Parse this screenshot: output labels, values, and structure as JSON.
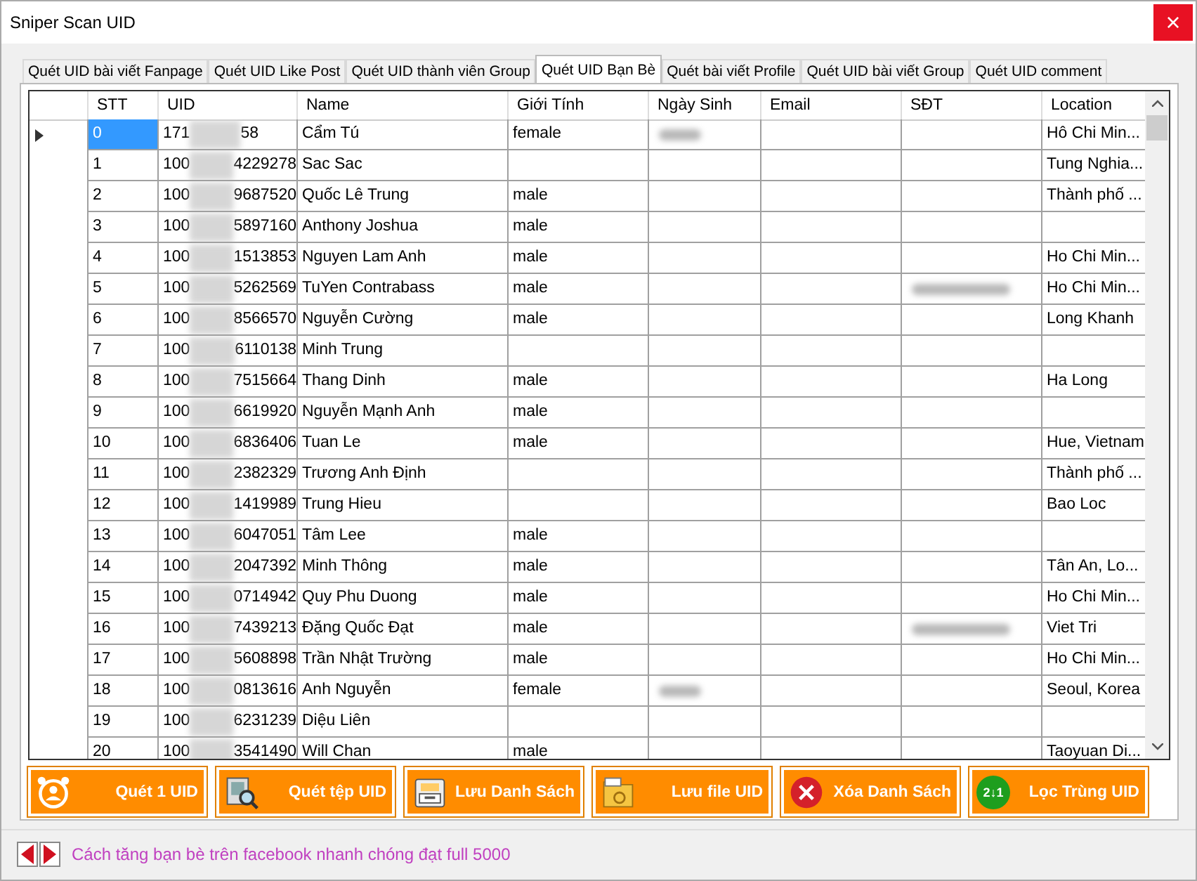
{
  "window": {
    "title": "Sniper Scan UID",
    "close": "×"
  },
  "tabs": [
    {
      "label": "Quét UID bài viết Fanpage",
      "selected": false
    },
    {
      "label": "Quét UID Like Post",
      "selected": false
    },
    {
      "label": "Quét UID thành viên Group",
      "selected": false
    },
    {
      "label": "Quét UID Bạn Bè",
      "selected": true
    },
    {
      "label": "Quét bài viết Profile",
      "selected": false
    },
    {
      "label": "Quét UID bài viết Group",
      "selected": false
    },
    {
      "label": "Quét UID comment",
      "selected": false
    }
  ],
  "table": {
    "columns": [
      "STT",
      "UID",
      "Name",
      "Giới Tính",
      "Ngày Sinh",
      "Email",
      "SĐT",
      "Location"
    ],
    "rows": [
      {
        "stt": "0",
        "uid_start": "171",
        "uid_end": "58",
        "name": "Cẩm Tú",
        "gender": "female",
        "birthday_blurred": true,
        "phone_blurred": false,
        "location": "Hô Chi Min...",
        "selected": true
      },
      {
        "stt": "1",
        "uid_start": "100",
        "uid_end": "4229278",
        "name": "Sac Sac",
        "gender": "",
        "birthday_blurred": false,
        "phone_blurred": false,
        "location": "Tung Nghia...",
        "selected": false
      },
      {
        "stt": "2",
        "uid_start": "100",
        "uid_end": "9687520",
        "name": "Quốc Lê Trung",
        "gender": "male",
        "birthday_blurred": false,
        "phone_blurred": false,
        "location": "Thành phố ...",
        "selected": false
      },
      {
        "stt": "3",
        "uid_start": "100",
        "uid_end": "5897160",
        "name": "Anthony Joshua",
        "gender": "male",
        "birthday_blurred": false,
        "phone_blurred": false,
        "location": "",
        "selected": false
      },
      {
        "stt": "4",
        "uid_start": "100",
        "uid_end": "1513853",
        "name": "Nguyen Lam Anh",
        "gender": "male",
        "birthday_blurred": false,
        "phone_blurred": false,
        "location": "Ho Chi Min...",
        "selected": false
      },
      {
        "stt": "5",
        "uid_start": "100",
        "uid_end": "5262569",
        "name": "TuYen Contrabass",
        "gender": "male",
        "birthday_blurred": false,
        "phone_blurred": true,
        "location": "Ho Chi Min...",
        "selected": false
      },
      {
        "stt": "6",
        "uid_start": "100",
        "uid_end": "8566570",
        "name": "Nguyễn Cường",
        "gender": "male",
        "birthday_blurred": false,
        "phone_blurred": false,
        "location": "Long Khanh",
        "selected": false
      },
      {
        "stt": "7",
        "uid_start": "100",
        "uid_end": "6110138",
        "name": "Minh Trung",
        "gender": "",
        "birthday_blurred": false,
        "phone_blurred": false,
        "location": "",
        "selected": false
      },
      {
        "stt": "8",
        "uid_start": "100",
        "uid_end": "7515664",
        "name": "Thang Dinh",
        "gender": "male",
        "birthday_blurred": false,
        "phone_blurred": false,
        "location": "Ha Long",
        "selected": false
      },
      {
        "stt": "9",
        "uid_start": "100",
        "uid_end": "6619920",
        "name": "Nguyễn Mạnh Anh",
        "gender": "male",
        "birthday_blurred": false,
        "phone_blurred": false,
        "location": "",
        "selected": false
      },
      {
        "stt": "10",
        "uid_start": "100",
        "uid_end": "6836406",
        "name": "Tuan Le",
        "gender": "male",
        "birthday_blurred": false,
        "phone_blurred": false,
        "location": "Hue, Vietnam",
        "selected": false
      },
      {
        "stt": "11",
        "uid_start": "100",
        "uid_end": "2382329",
        "name": "Trương Anh Định",
        "gender": "",
        "birthday_blurred": false,
        "phone_blurred": false,
        "location": "Thành phố ...",
        "selected": false
      },
      {
        "stt": "12",
        "uid_start": "100",
        "uid_end": "1419989",
        "name": "Trung Hieu",
        "gender": "",
        "birthday_blurred": false,
        "phone_blurred": false,
        "location": "Bao Loc",
        "selected": false
      },
      {
        "stt": "13",
        "uid_start": "100",
        "uid_end": "6047051",
        "name": "Tâm Lee",
        "gender": "male",
        "birthday_blurred": false,
        "phone_blurred": false,
        "location": "",
        "selected": false
      },
      {
        "stt": "14",
        "uid_start": "100",
        "uid_end": "2047392",
        "name": "Minh Thông",
        "gender": "male",
        "birthday_blurred": false,
        "phone_blurred": false,
        "location": "Tân An, Lo...",
        "selected": false
      },
      {
        "stt": "15",
        "uid_start": "100",
        "uid_end": "0714942",
        "name": "Quy Phu Duong",
        "gender": "male",
        "birthday_blurred": false,
        "phone_blurred": false,
        "location": "Ho Chi Min...",
        "selected": false
      },
      {
        "stt": "16",
        "uid_start": "100",
        "uid_end": "7439213",
        "name": "Đặng Quốc Đạt",
        "gender": "male",
        "birthday_blurred": false,
        "phone_blurred": true,
        "location": "Viet Tri",
        "selected": false
      },
      {
        "stt": "17",
        "uid_start": "100",
        "uid_end": "5608898",
        "name": "Trần Nhật Trường",
        "gender": "male",
        "birthday_blurred": false,
        "phone_blurred": false,
        "location": "Ho Chi Min...",
        "selected": false
      },
      {
        "stt": "18",
        "uid_start": "100",
        "uid_end": "0813616",
        "name": "Anh Nguyễn",
        "gender": "female",
        "birthday_blurred": true,
        "phone_blurred": false,
        "location": "Seoul, Korea",
        "selected": false
      },
      {
        "stt": "19",
        "uid_start": "100",
        "uid_end": "6231239",
        "name": "Diệu Liên",
        "gender": "",
        "birthday_blurred": false,
        "phone_blurred": false,
        "location": "",
        "selected": false
      },
      {
        "stt": "20",
        "uid_start": "100",
        "uid_end": "3541490",
        "name": "Will Chan",
        "gender": "male",
        "birthday_blurred": false,
        "phone_blurred": false,
        "location": "Taoyuan Di...",
        "selected": false
      }
    ]
  },
  "buttons": [
    {
      "label": "Quét 1 UID",
      "kind": "person"
    },
    {
      "label": "Quét tệp UID",
      "kind": "scan"
    },
    {
      "label": "Lưu Danh Sách",
      "kind": "cabinet"
    },
    {
      "label": "Lưu file UID",
      "kind": "txt"
    },
    {
      "label": "Xóa Danh Sách",
      "kind": "delete"
    },
    {
      "label": "Lọc Trùng UID",
      "kind": "sort",
      "badge": "2↓1"
    }
  ],
  "footer": {
    "link": "Cách tăng bạn bè trên facebook nhanh chóng đạt full 5000"
  }
}
